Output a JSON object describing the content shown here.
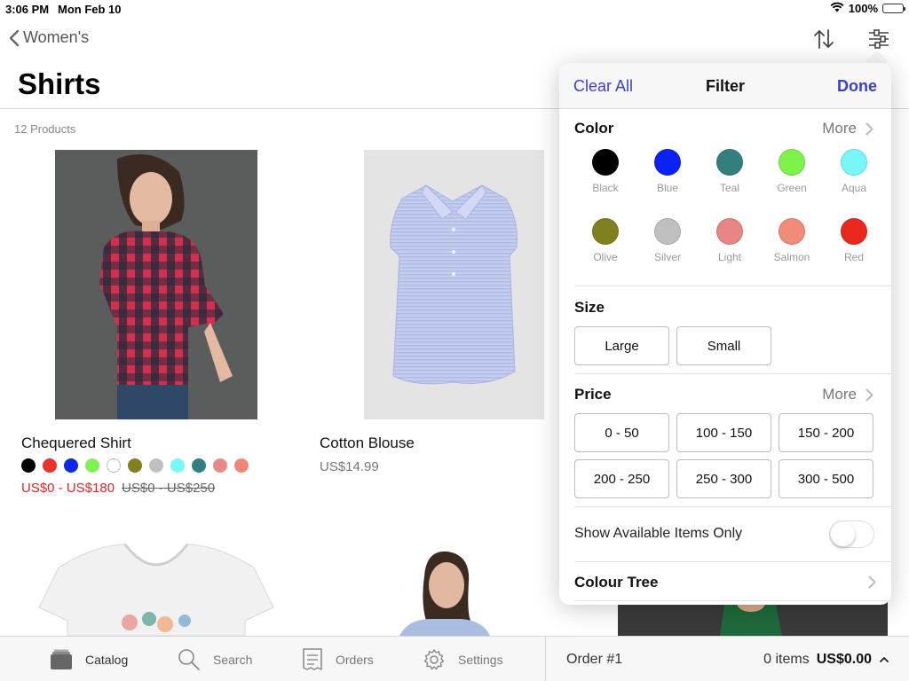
{
  "status_bar": {
    "time": "3:06 PM",
    "date": "Mon Feb 10",
    "battery": "100%"
  },
  "nav": {
    "back_label": "Women's"
  },
  "page": {
    "title": "Shirts",
    "product_count": "12 Products"
  },
  "products": [
    {
      "name": "Chequered Shirt",
      "price_sale": "US$0 - US$180",
      "price_original": "US$0 - US$250",
      "swatches": [
        "#000000",
        "#e8342b",
        "#0a28f0",
        "#7df255",
        "#ffffff",
        "#808020",
        "#c0c0c0",
        "#7af7f7",
        "#327f7f",
        "#e68a8a",
        "#f0887a"
      ]
    },
    {
      "name": "Cotton Blouse",
      "price": "US$14.99"
    }
  ],
  "filter": {
    "clear_all": "Clear All",
    "title": "Filter",
    "done": "Done",
    "color_title": "Color",
    "more": "More",
    "colors": [
      {
        "name": "Black",
        "hex": "#000000"
      },
      {
        "name": "Blue",
        "hex": "#0a22f2"
      },
      {
        "name": "Teal",
        "hex": "#327f7f"
      },
      {
        "name": "Green",
        "hex": "#7df24a"
      },
      {
        "name": "Aqua",
        "hex": "#79f6f8"
      },
      {
        "name": "Olive",
        "hex": "#80801f"
      },
      {
        "name": "Silver",
        "hex": "#c0c0c0"
      },
      {
        "name": "Light",
        "hex": "#e88585"
      },
      {
        "name": "Salmon",
        "hex": "#f08c78"
      },
      {
        "name": "Red",
        "hex": "#e9291f"
      }
    ],
    "size_title": "Size",
    "sizes": [
      "Large",
      "Small"
    ],
    "price_title": "Price",
    "prices": [
      "0 - 50",
      "100 - 150",
      "150 - 200",
      "200 - 250",
      "250 - 300",
      "300 - 500"
    ],
    "available_label": "Show Available Items Only",
    "available_on": false,
    "colour_tree": "Colour Tree"
  },
  "tabs": [
    {
      "label": "Catalog",
      "icon": "catalog-icon",
      "active": true
    },
    {
      "label": "Search",
      "icon": "search-icon",
      "active": false
    },
    {
      "label": "Orders",
      "icon": "orders-icon",
      "active": false
    },
    {
      "label": "Settings",
      "icon": "gear-icon",
      "active": false
    }
  ],
  "order": {
    "label": "Order #1",
    "items": "0 items",
    "total": "US$0.00"
  },
  "colors": {
    "accent": "#3c3fc6",
    "sale": "#d9252c"
  }
}
